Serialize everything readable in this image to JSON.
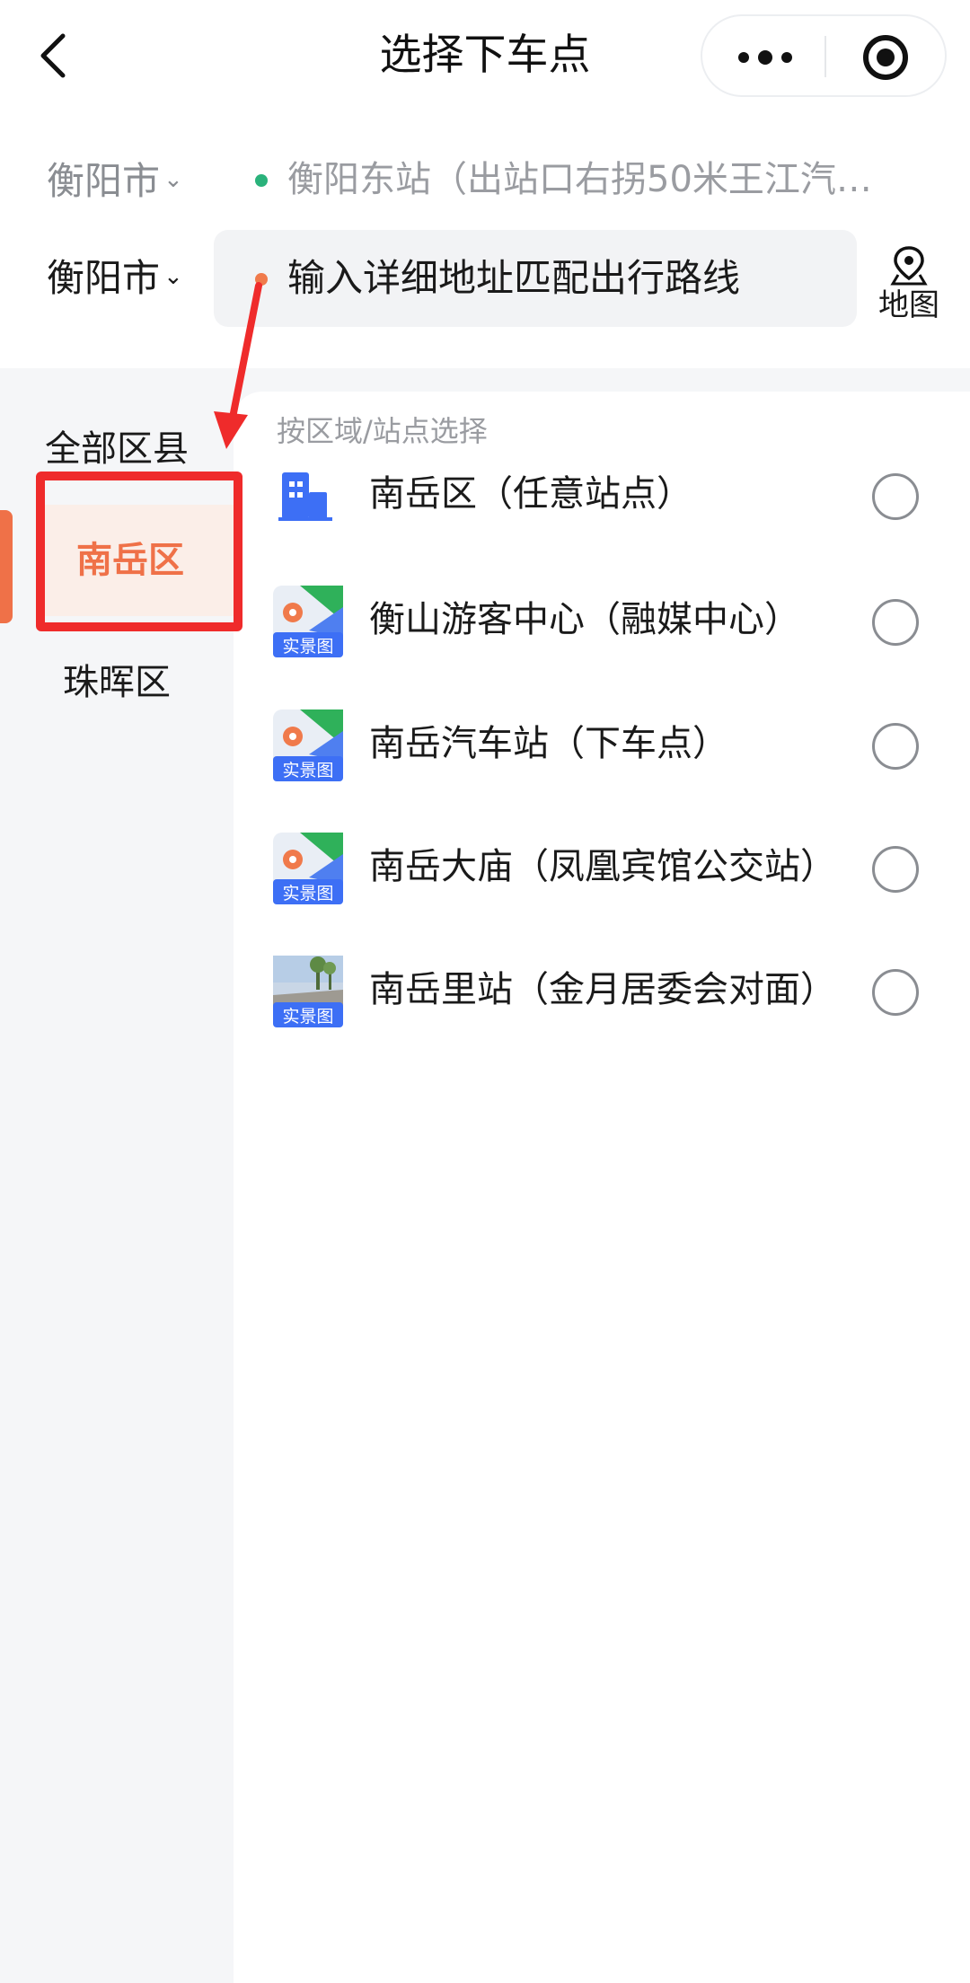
{
  "header": {
    "back_icon": "chevron-left-icon",
    "title": "选择下车点",
    "more_icon": "more-dots-icon",
    "close_icon": "target-circle-icon"
  },
  "origin": {
    "city": "衡阳市",
    "address": "衡阳东站（出站口右拐50米王江汽…",
    "dot_color": "#2ab27b"
  },
  "destination": {
    "city": "衡阳市",
    "placeholder": "输入详细地址匹配出行路线",
    "dot_color": "#f07a4b",
    "map_label": "地图",
    "map_icon": "map-pin-icon"
  },
  "sidebar": {
    "items": [
      {
        "label": "全部区县",
        "active": false
      },
      {
        "label": "南岳区",
        "active": true
      },
      {
        "label": "珠晖区",
        "active": false
      }
    ],
    "accent_color": "#ef7148"
  },
  "panel": {
    "heading": "按区域/站点选择",
    "stations": [
      {
        "name": "南岳区（任意站点）",
        "icon": "building-icon",
        "selected": false
      },
      {
        "name": "衡山游客中心（融媒中心）",
        "icon": "live-view-map-icon",
        "icon_label": "实景图",
        "selected": false
      },
      {
        "name": "南岳汽车站（下车点）",
        "icon": "live-view-map-icon",
        "icon_label": "实景图",
        "selected": false
      },
      {
        "name": "南岳大庙（凤凰宾馆公交站）",
        "icon": "live-view-map-icon",
        "icon_label": "实景图",
        "selected": false
      },
      {
        "name": "南岳里站（金月居委会对面）",
        "icon": "live-view-photo-icon",
        "icon_label": "实景图",
        "selected": false
      }
    ]
  },
  "annotation": {
    "color": "#ef2b2b",
    "arrow_icon": "red-arrow-icon"
  }
}
